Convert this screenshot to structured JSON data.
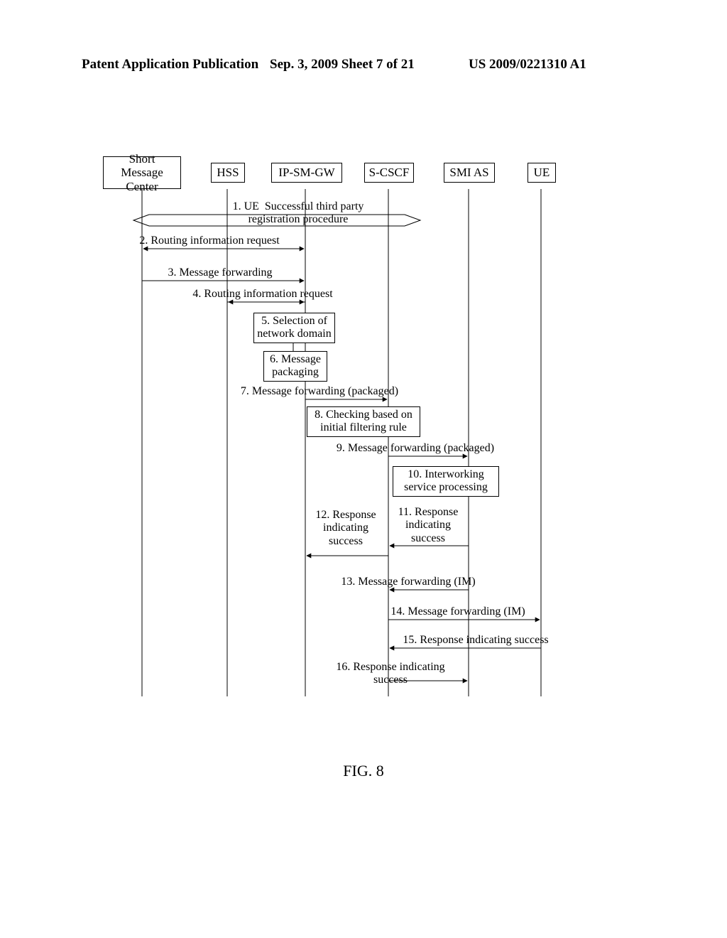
{
  "header": {
    "left": "Patent Application Publication",
    "middle": "Sep. 3, 2009  Sheet 7 of 21",
    "right": "US 2009/0221310 A1"
  },
  "figure_caption": "FIG. 8",
  "lifelines": {
    "smc": "Short Message\nCenter",
    "hss": "HSS",
    "ipgw": "IP-SM-GW",
    "scscf": "S-CSCF",
    "smias": "SMI AS",
    "ue": "UE"
  },
  "messages": {
    "m1": "1. UE  Successful third party\nregistration procedure",
    "m2": "2. Routing information request",
    "m3": "3. Message forwarding",
    "m4": "4. Routing information request",
    "m5": "5. Selection of\nnetwork domain",
    "m6": "6. Message\npackaging",
    "m7": "7. Message forwarding (packaged)",
    "m8": "8. Checking based on\ninitial filtering rule",
    "m9": "9. Message forwarding (packaged)",
    "m10": "10. Interworking\nservice processing",
    "m11": "11. Response\nindicating\nsuccess",
    "m12": "12. Response\nindicating\nsuccess",
    "m13": "13. Message forwarding (IM)",
    "m14": "14. Message forwarding (IM)",
    "m15": "15. Response indicating success",
    "m16": "16. Response indicating\nsuccess"
  },
  "chart_data": {
    "type": "sequence_diagram",
    "participants": [
      "Short Message Center",
      "HSS",
      "IP-SM-GW",
      "S-CSCF",
      "SMI AS",
      "UE"
    ],
    "steps": [
      {
        "n": 1,
        "label": "UE Successful third party registration procedure",
        "kind": "shuttle_span",
        "span_from": "Short Message Center",
        "span_to": "S-CSCF"
      },
      {
        "n": 2,
        "label": "Routing information request",
        "from": "HSS",
        "to": "Short Message Center",
        "also": {
          "from": "HSS",
          "to": "IP-SM-GW"
        }
      },
      {
        "n": 3,
        "label": "Message forwarding",
        "from": "Short Message Center",
        "to": "IP-SM-GW"
      },
      {
        "n": 4,
        "label": "Routing information request",
        "from": "IP-SM-GW",
        "to": "HSS",
        "also": {
          "from": "HSS",
          "to": "IP-SM-GW"
        }
      },
      {
        "n": 5,
        "label": "Selection of network domain",
        "at": "IP-SM-GW",
        "kind": "self_note"
      },
      {
        "n": 6,
        "label": "Message packaging",
        "at": "IP-SM-GW",
        "kind": "self_note"
      },
      {
        "n": 7,
        "label": "Message forwarding (packaged)",
        "from": "IP-SM-GW",
        "to": "S-CSCF"
      },
      {
        "n": 8,
        "label": "Checking based on initial filtering rule",
        "at": "S-CSCF",
        "kind": "self_note"
      },
      {
        "n": 9,
        "label": "Message forwarding (packaged)",
        "from": "S-CSCF",
        "to": "SMI AS"
      },
      {
        "n": 10,
        "label": "Interworking service processing",
        "at": "SMI AS",
        "kind": "self_note"
      },
      {
        "n": 11,
        "label": "Response indicating success",
        "from": "SMI AS",
        "to": "S-CSCF"
      },
      {
        "n": 12,
        "label": "Response indicating success",
        "from": "S-CSCF",
        "to": "IP-SM-GW"
      },
      {
        "n": 13,
        "label": "Message forwarding (IM)",
        "from": "SMI AS",
        "to": "S-CSCF"
      },
      {
        "n": 14,
        "label": "Message forwarding (IM)",
        "from": "S-CSCF",
        "to": "UE"
      },
      {
        "n": 15,
        "label": "Response indicating success",
        "from": "UE",
        "to": "S-CSCF"
      },
      {
        "n": 16,
        "label": "Response indicating success",
        "from": "S-CSCF",
        "to": "SMI AS"
      }
    ]
  }
}
